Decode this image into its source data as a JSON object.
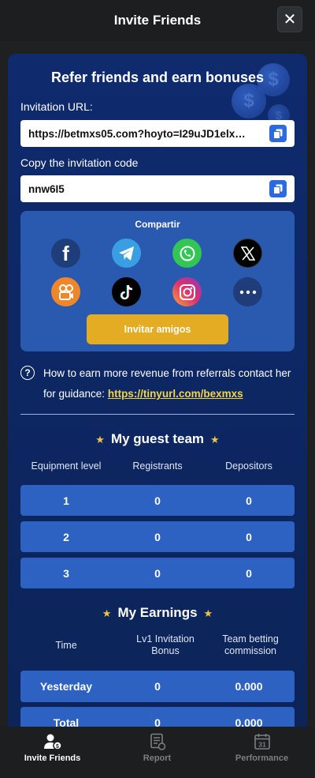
{
  "header": {
    "title": "Invite Friends",
    "close": "✕"
  },
  "main": {
    "headline": "Refer friends and earn bonuses",
    "invitation_url_label": "Invitation URL:",
    "invitation_url": "https://betmxs05.com?hoyto=I29uJD1elx…",
    "invitation_code_label": "Copy the invitation code",
    "invitation_code": "nnw6I5"
  },
  "share": {
    "title": "Compartir",
    "networks": [
      "facebook-icon",
      "telegram-icon",
      "whatsapp-icon",
      "x-icon",
      "kwai-icon",
      "tiktok-icon",
      "instagram-icon",
      "more-icon"
    ],
    "invite_button": "Invitar amigos"
  },
  "help": {
    "text": "How to earn more revenue from referrals contact her for guidance:",
    "link": "https://tinyurl.com/bexmxs"
  },
  "guest_team": {
    "title": "My guest team",
    "columns": [
      "Equipment level",
      "Registrants",
      "Depositors"
    ],
    "rows": [
      [
        "1",
        "0",
        "0"
      ],
      [
        "2",
        "0",
        "0"
      ],
      [
        "3",
        "0",
        "0"
      ]
    ]
  },
  "earnings": {
    "title": "My Earnings",
    "columns": [
      "Time",
      "Lv1 Invitation Bonus",
      "Team betting commission"
    ],
    "rows": [
      [
        "Yesterday",
        "0",
        "0.000"
      ],
      [
        "Total",
        "0",
        "0.000"
      ]
    ]
  },
  "bottom_nav": {
    "items": [
      {
        "label": "Invite Friends",
        "icon": "invite-friends-icon",
        "active": true
      },
      {
        "label": "Report",
        "icon": "report-icon",
        "active": false
      },
      {
        "label": "Performance",
        "icon": "calendar-icon",
        "active": false
      }
    ],
    "calendar_day": "31"
  },
  "colors": {
    "accent_button": "#e4ac22",
    "link": "#f5d442",
    "row_bg": "#2d62c2",
    "card_bg": "#0f2b6e"
  }
}
